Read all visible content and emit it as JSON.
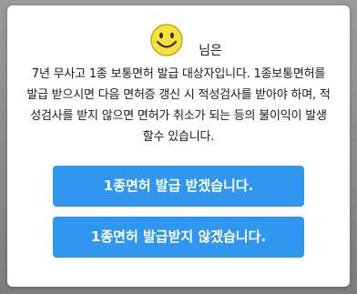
{
  "dialog": {
    "greeting_suffix": "님은",
    "message": "7년 무사고 1종 보통면허 발급 대상자입니다. 1종보통면허를 발급 받으시면 다음 면허증 갱신 시 적성검사를 받아야 하며, 적성검사를 받지 않으면 면허가 취소가 되는 등의 불이익이 발생할수 있습니다.",
    "accept_label": "1종면허 발급 받겠습니다.",
    "decline_label": "1종면허 발급받지 않겠습니다."
  },
  "colors": {
    "button": "#2f97f0",
    "smiley": "#f7e13c"
  },
  "icons": {
    "smiley": "smiley-face-icon"
  }
}
